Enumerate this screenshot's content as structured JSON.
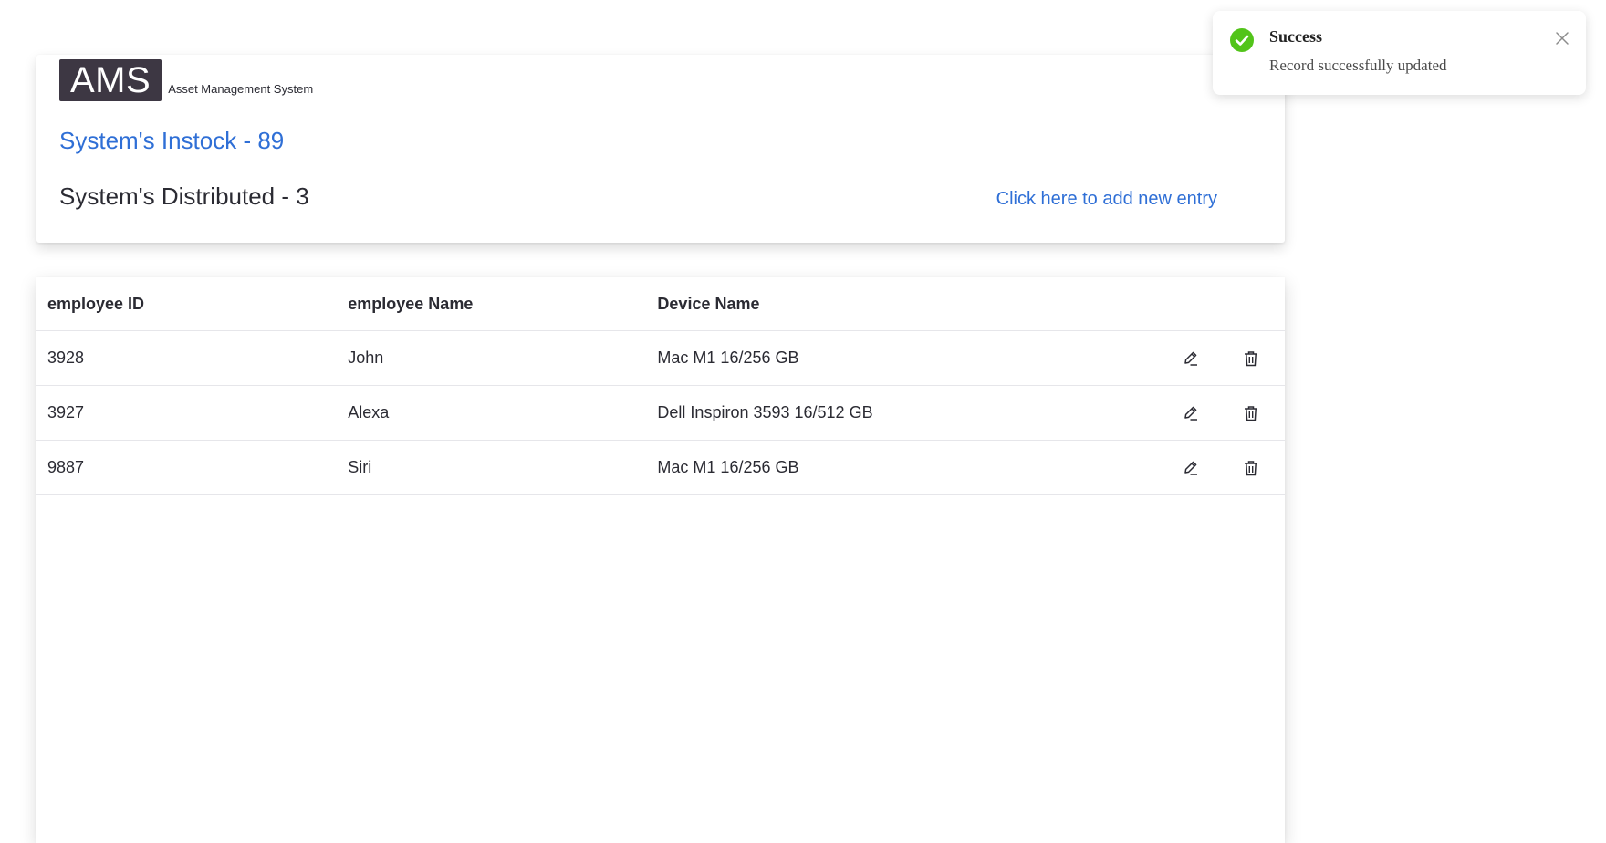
{
  "header": {
    "logo_text": "AMS",
    "logo_subtitle": "Asset Management System",
    "instock_text": "System's Instock - 89",
    "distributed_text": "System's Distributed - 3",
    "add_entry_link": "Click here to add new entry"
  },
  "table": {
    "columns": [
      "employee ID",
      "employee Name",
      "Device Name"
    ],
    "rows": [
      {
        "employee_id": "3928",
        "employee_name": "John",
        "device_name": "Mac M1 16/256 GB"
      },
      {
        "employee_id": "3927",
        "employee_name": "Alexa",
        "device_name": "Dell Inspiron 3593 16/512 GB"
      },
      {
        "employee_id": "9887",
        "employee_name": "Siri",
        "device_name": "Mac M1 16/256 GB"
      }
    ],
    "row_actions": [
      "edit-icon",
      "trash-icon"
    ]
  },
  "toast": {
    "title": "Success",
    "message": "Record successfully updated",
    "icon": "check-circle-icon",
    "close_icon": "close-icon",
    "status_color": "#52c41a"
  },
  "colors": {
    "accent": "#2f6fd6",
    "logo_bg": "#3d3743",
    "text": "#2b2b33"
  }
}
